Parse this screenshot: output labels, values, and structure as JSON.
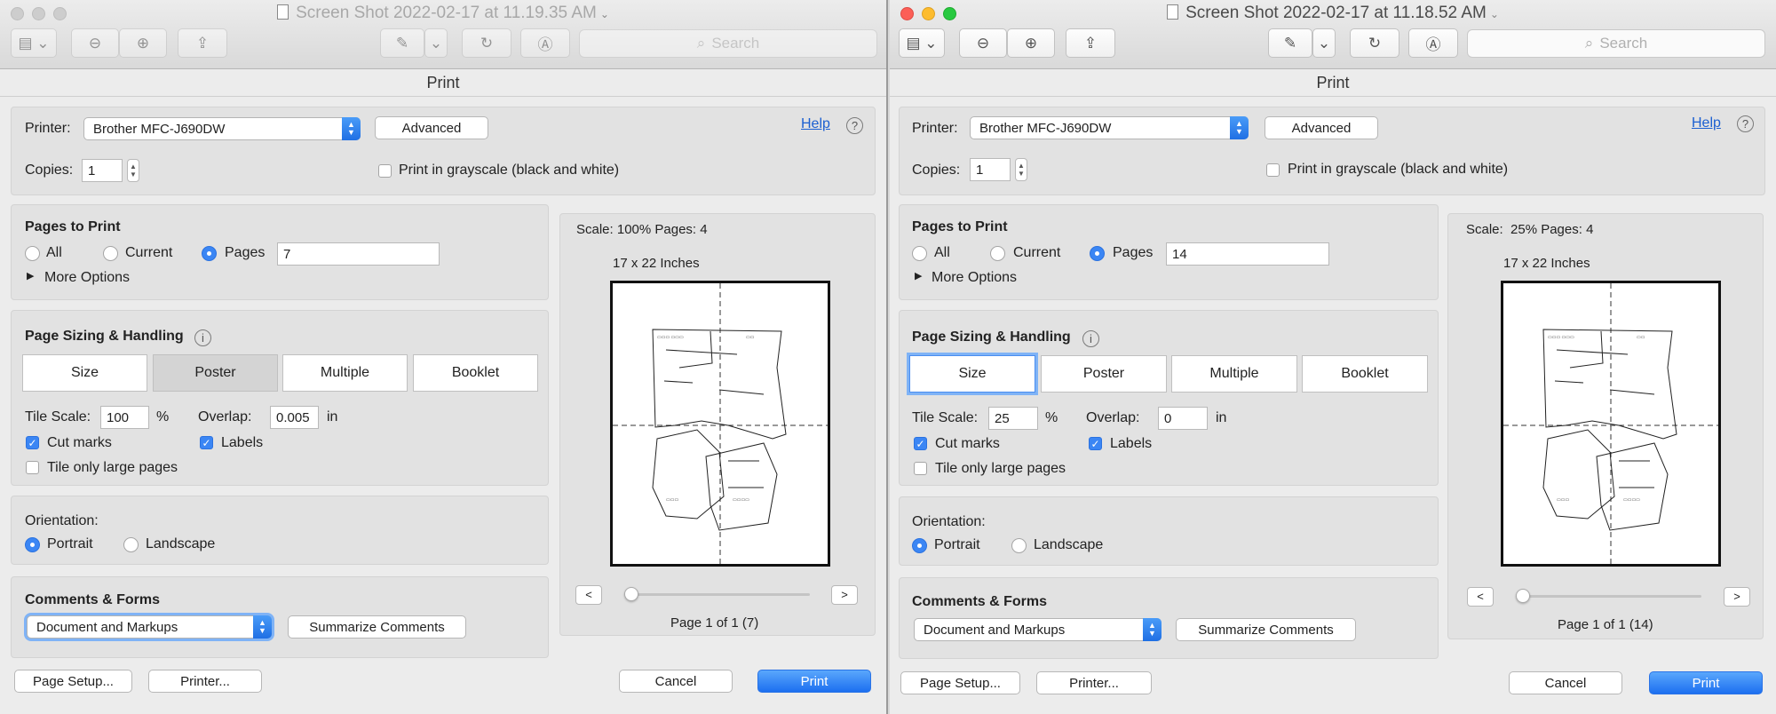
{
  "left": {
    "window_title": "Screen Shot 2022-02-17 at 11.19.35 AM",
    "search_placeholder": "Search",
    "dialog_title": "Print",
    "printer_label": "Printer:",
    "printer_value": "Brother MFC-J690DW",
    "advanced_label": "Advanced",
    "help_label": "Help",
    "copies_label": "Copies:",
    "copies_value": "1",
    "grayscale_label": "Print in grayscale (black and white)",
    "pages_to_print_label": "Pages to Print",
    "all_label": "All",
    "current_label": "Current",
    "pages_label": "Pages",
    "pages_value": "7",
    "more_options_label": "More Options",
    "page_sizing_label": "Page Sizing & Handling",
    "tabs": [
      "Size",
      "Poster",
      "Multiple",
      "Booklet"
    ],
    "tile_scale_label": "Tile Scale:",
    "tile_scale_value": "100",
    "percent": "%",
    "overlap_label": "Overlap:",
    "overlap_value": "0.005",
    "in_label": "in",
    "cut_marks_label": "Cut marks",
    "labels_label": "Labels",
    "tile_only_label": "Tile only large pages",
    "orientation_label": "Orientation:",
    "portrait_label": "Portrait",
    "landscape_label": "Landscape",
    "comments_forms_label": "Comments & Forms",
    "comments_value": "Document and Markups",
    "summarize_label": "Summarize Comments",
    "scale_text": "Scale: 100% Pages: 4",
    "paper_size": "17 x 22 Inches",
    "page_of": "Page 1 of 1 (7)",
    "page_setup_label": "Page Setup...",
    "printer_btn_label": "Printer...",
    "cancel_label": "Cancel",
    "print_label": "Print"
  },
  "right": {
    "window_title": "Screen Shot 2022-02-17 at 11.18.52 AM",
    "search_placeholder": "Search",
    "dialog_title": "Print",
    "printer_label": "Printer:",
    "printer_value": "Brother MFC-J690DW",
    "advanced_label": "Advanced",
    "help_label": "Help",
    "copies_label": "Copies:",
    "copies_value": "1",
    "grayscale_label": "Print in grayscale (black and white)",
    "pages_to_print_label": "Pages to Print",
    "all_label": "All",
    "current_label": "Current",
    "pages_label": "Pages",
    "pages_value": "14",
    "more_options_label": "More Options",
    "page_sizing_label": "Page Sizing & Handling",
    "tabs": [
      "Size",
      "Poster",
      "Multiple",
      "Booklet"
    ],
    "tile_scale_label": "Tile Scale:",
    "tile_scale_value": "25",
    "percent": "%",
    "overlap_label": "Overlap:",
    "overlap_value": "0",
    "in_label": "in",
    "cut_marks_label": "Cut marks",
    "labels_label": "Labels",
    "tile_only_label": "Tile only large pages",
    "orientation_label": "Orientation:",
    "portrait_label": "Portrait",
    "landscape_label": "Landscape",
    "comments_forms_label": "Comments & Forms",
    "comments_value": "Document and Markups",
    "summarize_label": "Summarize Comments",
    "scale_text": "Scale:  25% Pages: 4",
    "paper_size": "17 x 22 Inches",
    "page_of": "Page 1 of 1 (14)",
    "page_setup_label": "Page Setup...",
    "printer_btn_label": "Printer...",
    "cancel_label": "Cancel",
    "print_label": "Print"
  }
}
